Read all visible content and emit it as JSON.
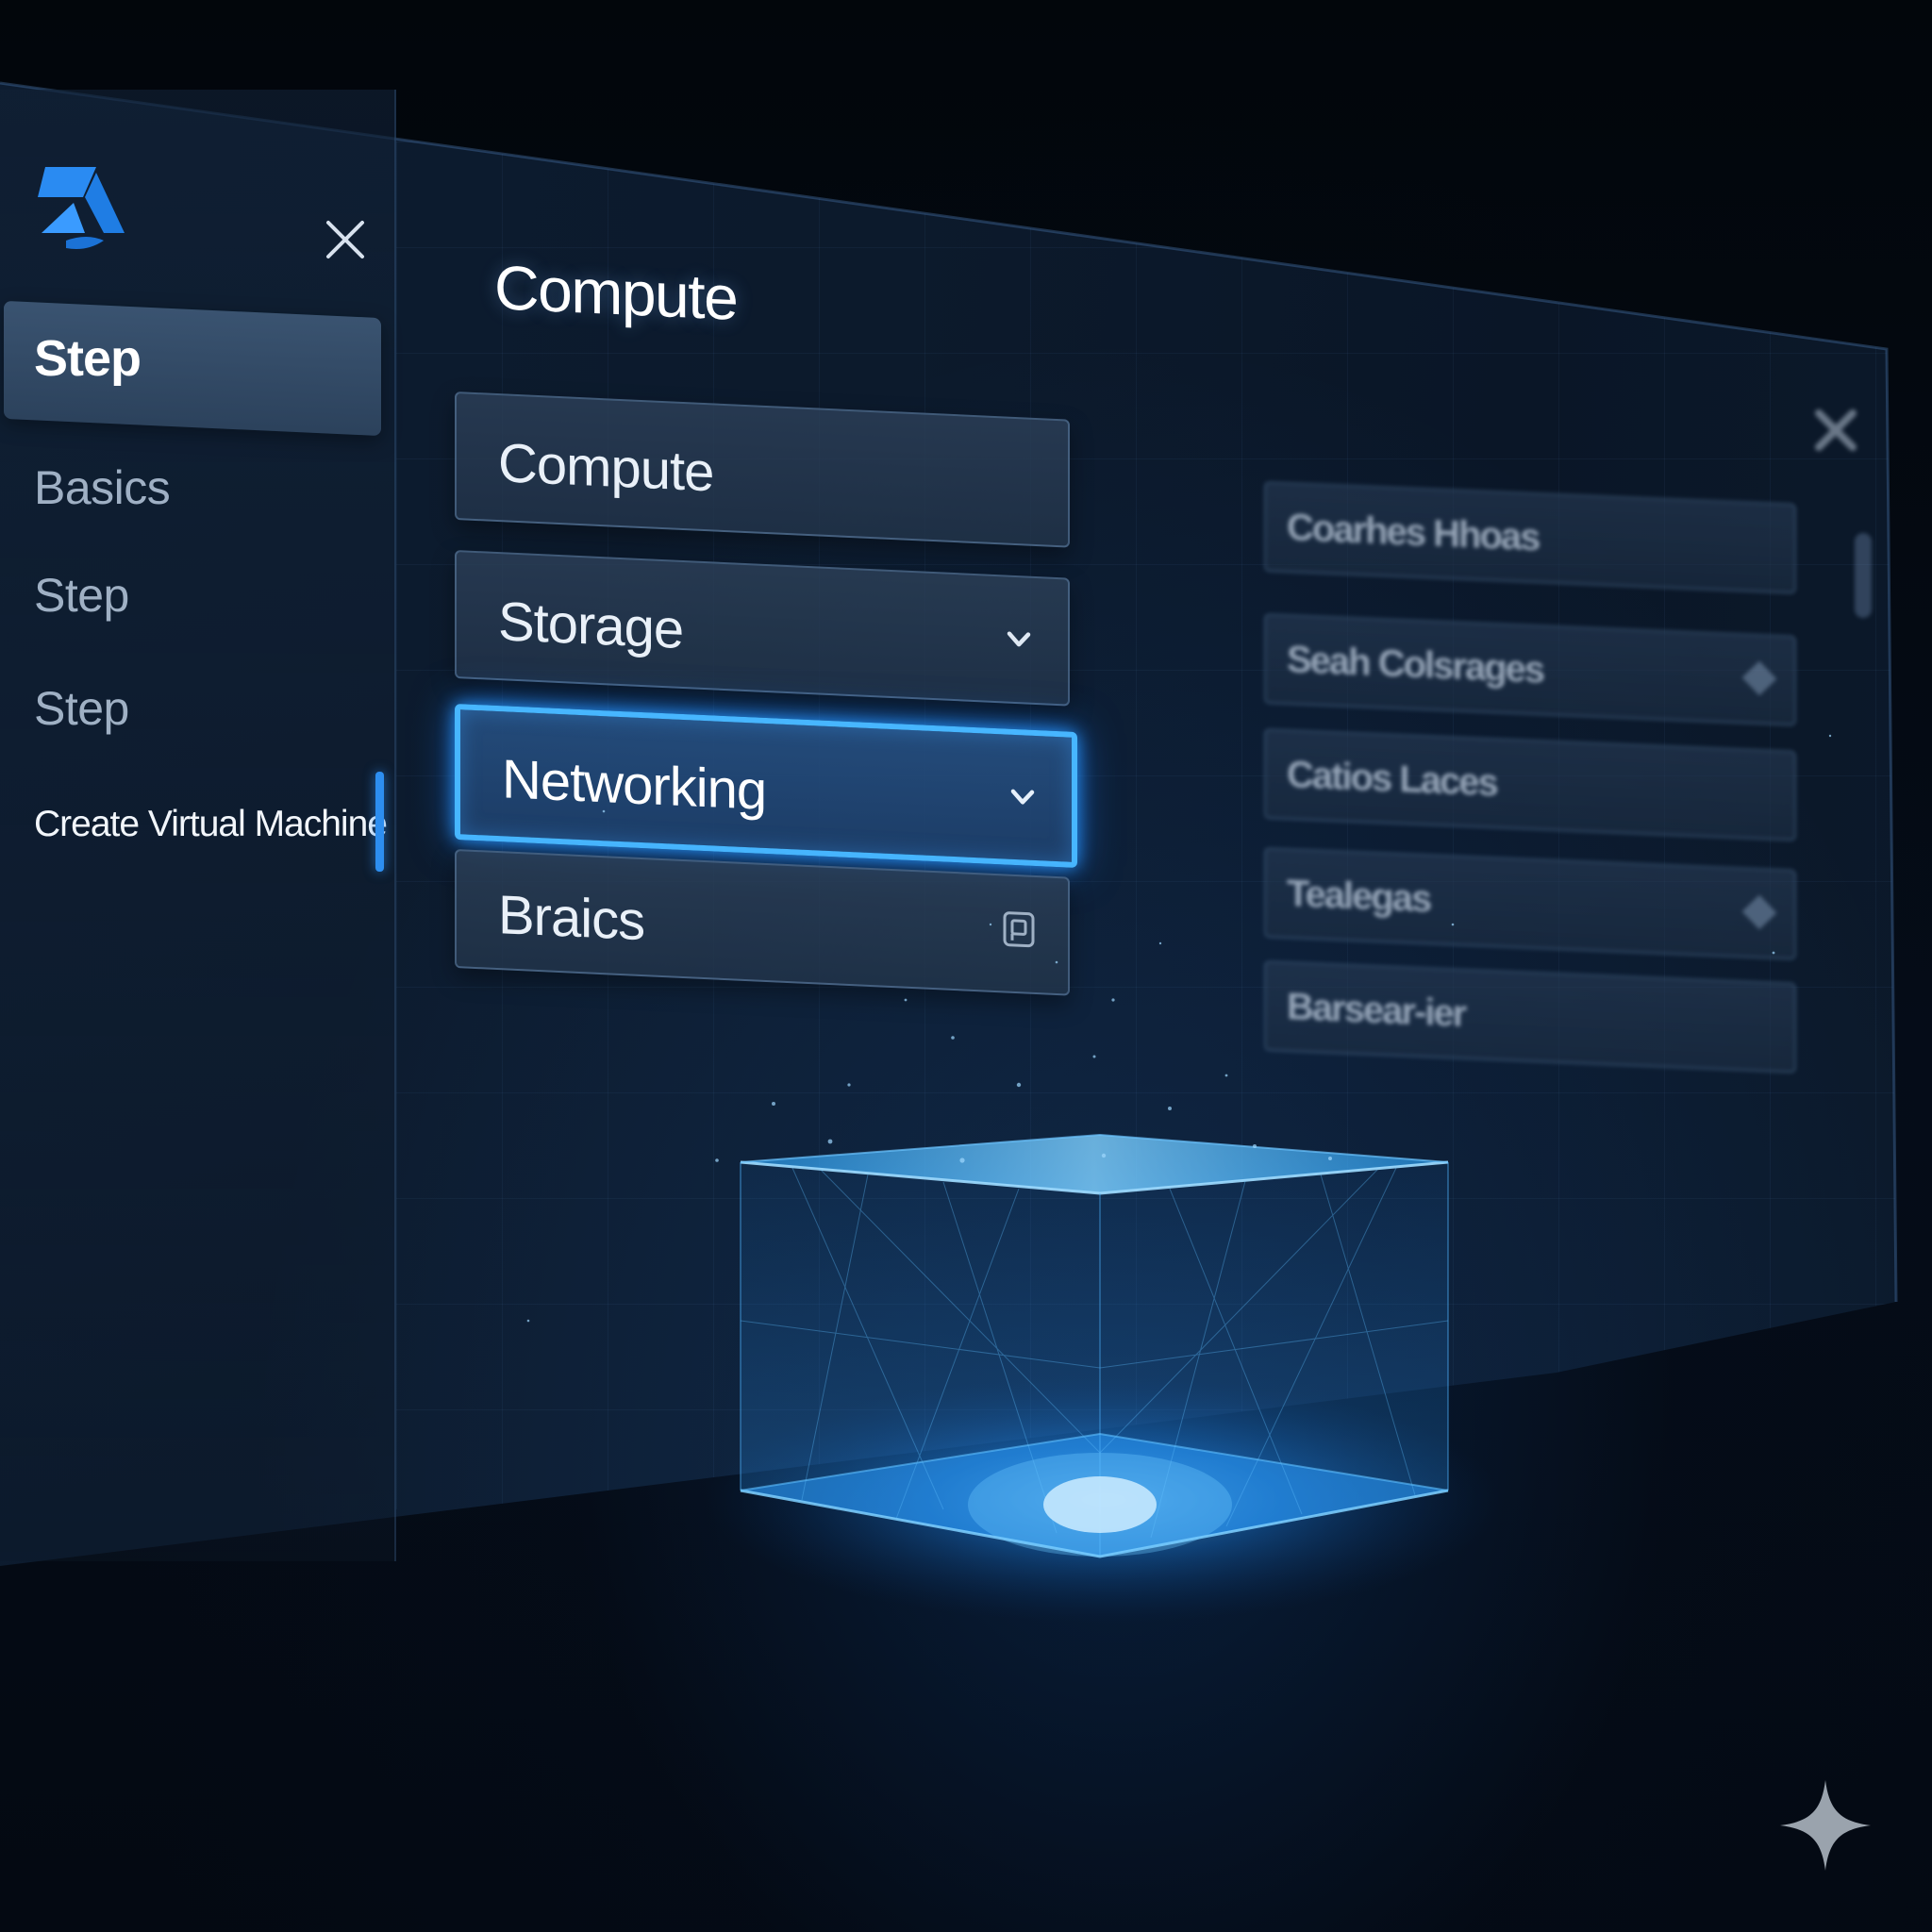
{
  "sidebar": {
    "active_label": "Step",
    "items": [
      {
        "label": "Basics"
      },
      {
        "label": "Step"
      },
      {
        "label": "Step"
      }
    ],
    "current_label": "Create Virtual Machine"
  },
  "main": {
    "title": "Compute",
    "options": [
      {
        "label": "Compute"
      },
      {
        "label": "Storage"
      },
      {
        "label": "Networking"
      },
      {
        "label": "Braics"
      }
    ],
    "selected": "Networking"
  },
  "blurred_panel": {
    "rows": [
      {
        "label": "Coarhes Hhoas"
      },
      {
        "label": "Seah Colsrages"
      },
      {
        "label": "Catios Laces"
      },
      {
        "label": "Tealegas"
      },
      {
        "label": "Barsear-ier"
      }
    ]
  },
  "icons": {
    "logo": "azure-logo-icon",
    "close": "close-icon",
    "chevron": "chevron-down-icon",
    "square": "square-icon",
    "sparkle": "sparkle-icon"
  },
  "colors": {
    "accent": "#47b6ff",
    "logo": "#2a8bf2",
    "background": "#03070d",
    "panel": "#0c1a2c"
  }
}
